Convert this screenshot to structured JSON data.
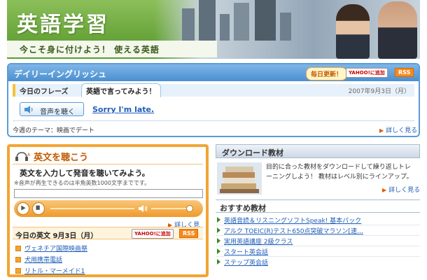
{
  "header": {
    "title": "英語学習",
    "subtitle": "今こそ身に付けよう！ 使える英語"
  },
  "daily": {
    "title": "デイリーイングリッシュ",
    "update_badge": "毎日更新！",
    "yahoo_badge": "YAHOO!に追加",
    "rss_badge": "RSS",
    "phrase_label": "今日のフレーズ",
    "phrase_tab": "英語で言ってみよう！",
    "date": "2007年9月3日（月）",
    "listen_button": "音声を聴く",
    "sentence": "Sorry I'm late.",
    "theme": "今週のテーマ：映画でデート",
    "more": "詳しく見る"
  },
  "listen": {
    "heading": "英文を聴こう",
    "instruction": "英文を入力して発音を聴いてみよう。",
    "note": "※音声が再生できるのは半角英数1000文字までです。",
    "input_value": "",
    "more": "詳しく見る",
    "today_label": "今日の英文 9月3日（月）",
    "yahoo_badge": "YAHOO!に追加",
    "rss_badge": "RSS",
    "items": [
      "ヴェネチア国際映画祭",
      "犬用携帯電話",
      "リトル・マーメイド1"
    ]
  },
  "download": {
    "title": "ダウンロード教材",
    "description": "目的に合った教材をダウンロードして繰り返しトレーニングしよう！ 教材はレベル別にラインアップ。",
    "more": "詳しく見る"
  },
  "recommended": {
    "title": "おすすめ教材",
    "items": [
      "英語音読＆リスニングソフトSpeak! 基本パック",
      "アルク TOEIC(R)テスト650点突破マラソン[速…",
      "実用英語講座 2級クラス",
      "スタート英会話",
      "ステップ英会話"
    ]
  },
  "colors": {
    "header_green": "#6aa63c",
    "panel_blue": "#5b9bd5",
    "orange": "#f2a533",
    "link_blue": "#1f5db8"
  }
}
